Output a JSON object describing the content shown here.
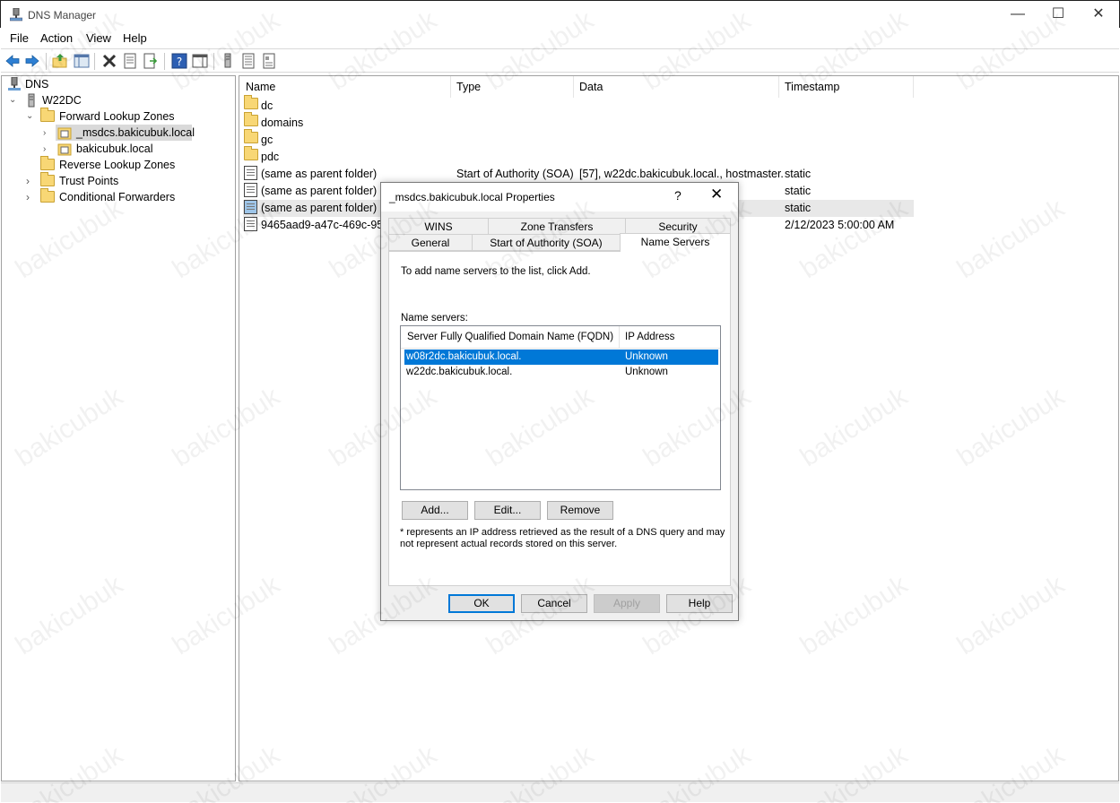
{
  "window": {
    "title": "DNS Manager",
    "minimize": "—",
    "maximize": "☐",
    "close": "✕"
  },
  "menu": [
    "File",
    "Action",
    "View",
    "Help"
  ],
  "tree": {
    "root": "DNS",
    "server": "W22DC",
    "forward_zones": "Forward Lookup Zones",
    "zone_msdcs": "_msdcs.bakicubuk.local",
    "zone_local": "bakicubuk.local",
    "reverse_zones": "Reverse Lookup Zones",
    "trust_points": "Trust Points",
    "conditional_forwarders": "Conditional Forwarders"
  },
  "list": {
    "columns": [
      "Name",
      "Type",
      "Data",
      "Timestamp"
    ],
    "rows": [
      {
        "name": "dc",
        "type": "",
        "data": "",
        "timestamp": ""
      },
      {
        "name": "domains",
        "type": "",
        "data": "",
        "timestamp": ""
      },
      {
        "name": "gc",
        "type": "",
        "data": "",
        "timestamp": ""
      },
      {
        "name": "pdc",
        "type": "",
        "data": "",
        "timestamp": ""
      },
      {
        "name": "(same as parent folder)",
        "type": "Start of Authority (SOA)",
        "data": "[57], w22dc.bakicubuk.local., hostmaster.",
        "timestamp": "static"
      },
      {
        "name": "(same as parent folder)",
        "type": "",
        "data": "",
        "timestamp": "static"
      },
      {
        "name": "(same as parent folder)",
        "type": "",
        "data": "",
        "timestamp": "static"
      },
      {
        "name": "9465aad9-a47c-469c-953f",
        "type": "",
        "data": "",
        "timestamp": "2/12/2023 5:00:00 AM"
      }
    ]
  },
  "dialog": {
    "title": "_msdcs.bakicubuk.local Properties",
    "help": "?",
    "close": "✕",
    "tabs_top": [
      "WINS",
      "Zone Transfers",
      "Security"
    ],
    "tabs_bottom": [
      "General",
      "Start of Authority (SOA)",
      "Name Servers"
    ],
    "instruction": "To add name servers to the list, click Add.",
    "list_label": "Name servers:",
    "col_fqdn": "Server Fully Qualified Domain Name (FQDN)",
    "col_ip": "IP Address",
    "servers": [
      {
        "fqdn": "w08r2dc.bakicubuk.local.",
        "ip": "Unknown"
      },
      {
        "fqdn": "w22dc.bakicubuk.local.",
        "ip": "Unknown"
      }
    ],
    "add": "Add...",
    "edit": "Edit...",
    "remove": "Remove",
    "note_line1": "* represents an IP address retrieved as the result of a DNS query and may",
    "note_line2": "not represent actual records stored on this server.",
    "ok": "OK",
    "cancel": "Cancel",
    "apply": "Apply",
    "help_button": "Help"
  },
  "watermark": "bakicubuk"
}
